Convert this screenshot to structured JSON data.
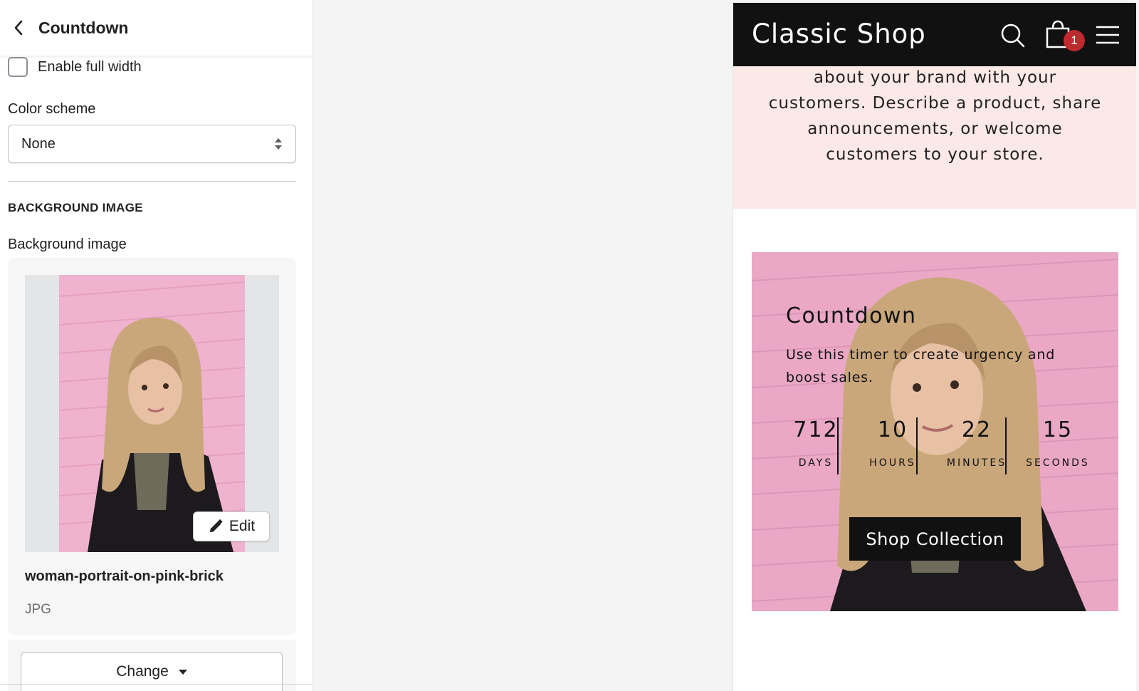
{
  "panel": {
    "title": "Countdown",
    "full_width_label": "Enable full width",
    "full_width_checked": false,
    "color_scheme_label": "Color scheme",
    "color_scheme_value": "None",
    "section_heading": "BACKGROUND IMAGE",
    "bg_image_label": "Background image",
    "image": {
      "edit_label": "Edit",
      "file_name": "woman-portrait-on-pink-brick",
      "file_type": "JPG"
    },
    "change_label": "Change"
  },
  "store": {
    "name": "Classic Shop",
    "cart_count": "1",
    "text_body": "about your brand with your customers. Describe a product, share announcements, or welcome customers to your store.",
    "countdown": {
      "title": "Countdown",
      "description": "Use this timer to create urgency and boost sales.",
      "units": [
        {
          "value": "712",
          "label": "DAYS"
        },
        {
          "value": "10",
          "label": "HOURS"
        },
        {
          "value": "22",
          "label": "MINUTES"
        },
        {
          "value": "15",
          "label": "SECONDS"
        }
      ],
      "button_label": "Shop Collection"
    }
  },
  "colors": {
    "nav_bg": "#111111",
    "text_section_bg": "#fbe9e7",
    "badge": "#c1292e",
    "photo_pink": "#e9a9c6"
  }
}
